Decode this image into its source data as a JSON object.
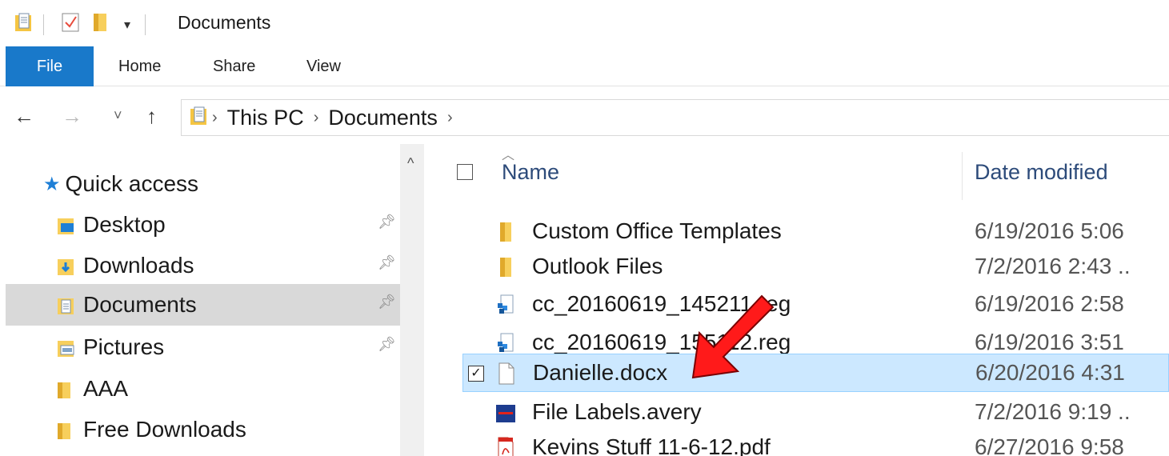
{
  "window": {
    "title": "Documents"
  },
  "ribbon": {
    "tabs": [
      {
        "label": "File",
        "active": true
      },
      {
        "label": "Home"
      },
      {
        "label": "Share"
      },
      {
        "label": "View"
      }
    ]
  },
  "address": {
    "crumbs": [
      "This PC",
      "Documents"
    ]
  },
  "nav": {
    "quick_access": "Quick access",
    "items": [
      {
        "label": "Desktop",
        "icon": "desktop-folder-icon",
        "pinned": true
      },
      {
        "label": "Downloads",
        "icon": "downloads-folder-icon",
        "pinned": true
      },
      {
        "label": "Documents",
        "icon": "documents-folder-icon",
        "pinned": true,
        "selected": true
      },
      {
        "label": "Pictures",
        "icon": "pictures-folder-icon",
        "pinned": true
      },
      {
        "label": "AAA",
        "icon": "folder-icon"
      },
      {
        "label": "Free Downloads",
        "icon": "folder-icon"
      }
    ]
  },
  "files": {
    "columns": {
      "name": "Name",
      "date": "Date modified"
    },
    "rows": [
      {
        "name": "Custom Office Templates",
        "date": "6/19/2016 5:06",
        "icon": "folder-icon"
      },
      {
        "name": "Outlook Files",
        "date": "7/2/2016 2:43 ..",
        "icon": "folder-icon"
      },
      {
        "name": "cc_20160619_145211.reg",
        "date": "6/19/2016 2:58",
        "icon": "registry-file-icon"
      },
      {
        "name": "cc_20160619_155112.reg",
        "date": "6/19/2016 3:51",
        "icon": "registry-file-icon"
      },
      {
        "name": "Danielle.docx",
        "date": "6/20/2016 4:31",
        "icon": "blank-file-icon",
        "selected": true,
        "checked": true
      },
      {
        "name": "File Labels.avery",
        "date": "7/2/2016 9:19 ..",
        "icon": "avery-file-icon"
      },
      {
        "name": "Kevins Stuff 11-6-12.pdf",
        "date": "6/27/2016 9:58",
        "icon": "pdf-file-icon"
      }
    ]
  },
  "colors": {
    "file_tab": "#1979ca",
    "nav_selected": "#d9d9d9",
    "row_selected": "#cce8ff",
    "arrow": "#ff1a1a"
  }
}
